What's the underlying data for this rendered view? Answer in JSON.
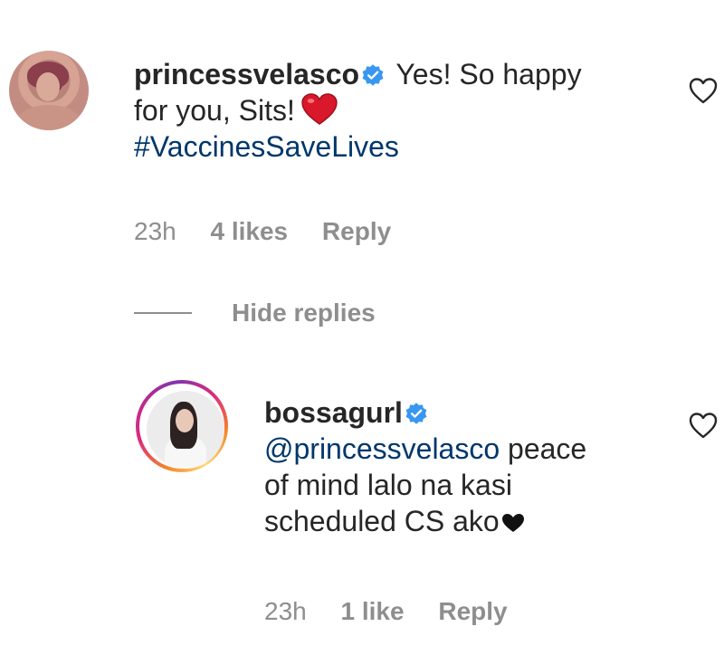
{
  "comments": [
    {
      "username": "princessvelasco",
      "verified": true,
      "text_line1": "Yes! So happy",
      "text_line2": "for you, Sits!",
      "emoji": "red-heart",
      "hashtag": "#VaccinesSaveLives",
      "time": "23h",
      "likes": "4 likes",
      "reply_label": "Reply"
    }
  ],
  "hide_replies_label": "Hide replies",
  "replies": [
    {
      "username": "bossagurl",
      "verified": true,
      "mention": "@princessvelasco",
      "text_line1": "peace",
      "text_line2": "of mind lalo na kasi",
      "text_line3": "scheduled CS ako",
      "emoji": "black-heart",
      "time": "23h",
      "likes": "1 like",
      "reply_label": "Reply"
    }
  ],
  "icons": {
    "like": "heart-outline-icon",
    "verified": "verified-badge-icon"
  },
  "colors": {
    "verified_blue": "#3897f0",
    "link_blue": "#00376b",
    "meta_gray": "#8e8e8e",
    "heart_red": "#e0245e"
  }
}
